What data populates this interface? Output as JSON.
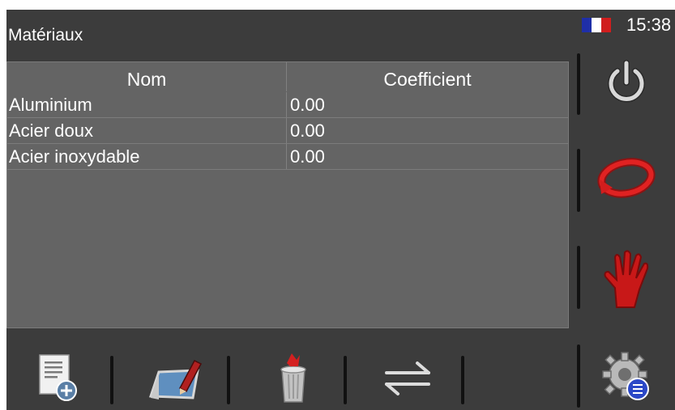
{
  "header": {
    "title": "Matériaux",
    "time": "15:38",
    "language_flag": "fr-flag-icon"
  },
  "table": {
    "columns": [
      "Nom",
      "Coefficient"
    ],
    "rows": [
      {
        "nom": "Aluminium",
        "coefficient": "0.00"
      },
      {
        "nom": "Acier doux",
        "coefficient": "0.00"
      },
      {
        "nom": "Acier inoxydable",
        "coefficient": "0.00"
      }
    ]
  },
  "side_buttons": [
    "power-icon",
    "refresh-icon",
    "stop-hand-icon",
    "settings-gear-icon"
  ],
  "bottom_buttons": [
    "new-document-icon",
    "edit-icon",
    "delete-trash-icon",
    "transfer-arrows-icon"
  ],
  "colors": {
    "screen_bg": "#3c3c3c",
    "table_bg": "#646464",
    "accent_red": "#d21f1f",
    "flag_blue": "#1f2fa8"
  }
}
